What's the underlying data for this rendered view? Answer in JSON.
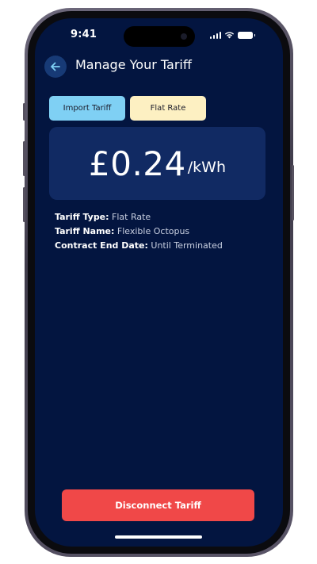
{
  "status_bar": {
    "time": "9:41"
  },
  "header": {
    "title": "Manage Your Tariff",
    "back_icon": "arrow-left-icon"
  },
  "tabs": [
    {
      "label": "Import Tariff",
      "color": "#7fd0f4"
    },
    {
      "label": "Flat Rate",
      "color": "#fdf0c2"
    }
  ],
  "price": {
    "value": "£0.24",
    "unit": "/kWh"
  },
  "details": {
    "tariff_type_label": "Tariff Type:",
    "tariff_type_value": "Flat Rate",
    "tariff_name_label": "Tariff Name:",
    "tariff_name_value": "Flexible Octopus",
    "contract_end_label": "Contract End Date:",
    "contract_end_value": "Until Terminated"
  },
  "actions": {
    "disconnect_label": "Disconnect Tariff"
  },
  "colors": {
    "background": "#031540",
    "card": "#112a63",
    "accent_blue": "#7fd0f4",
    "accent_yellow": "#fdf0c2",
    "danger": "#f04848"
  }
}
